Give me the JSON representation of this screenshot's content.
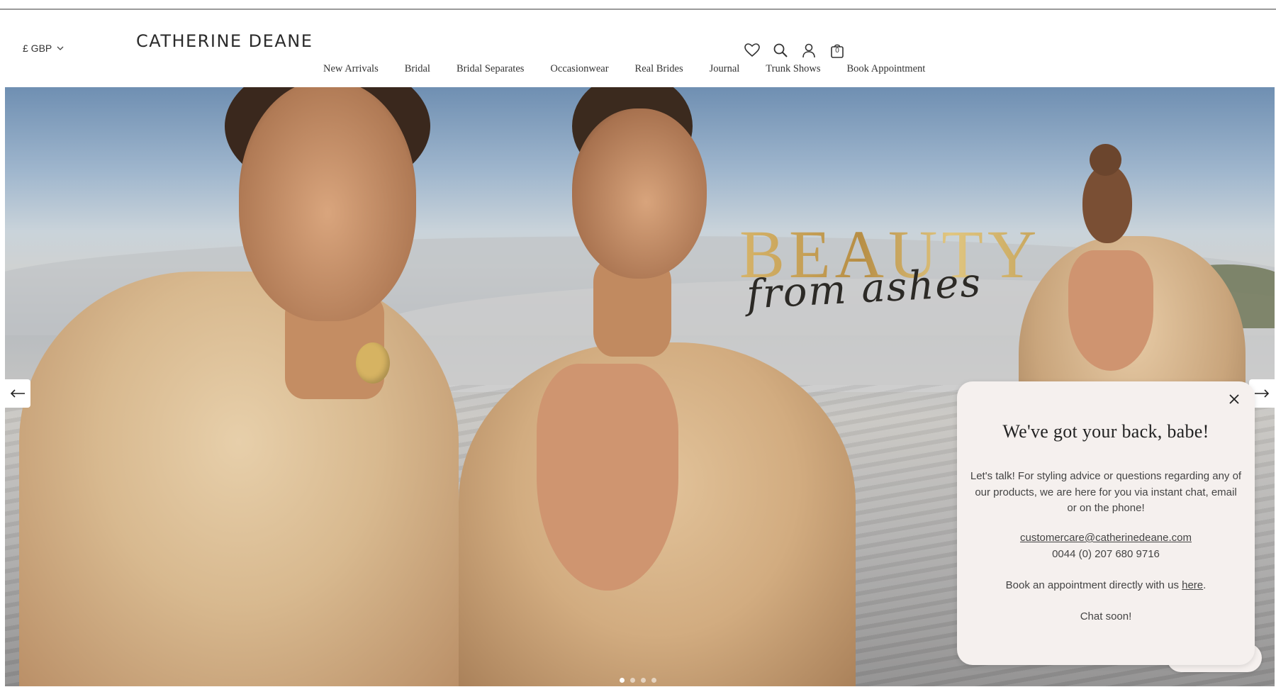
{
  "header": {
    "currency": "£ GBP",
    "logo": "CATHERINE DEANE",
    "icons": [
      "heart-icon",
      "search-icon",
      "account-icon",
      "bag-icon"
    ],
    "bag_count": "0",
    "nav": [
      "New Arrivals",
      "Bridal",
      "Bridal Separates",
      "Occasionwear",
      "Real Brides",
      "Journal",
      "Trunk Shows",
      "Book Appointment"
    ]
  },
  "hero": {
    "headline": "BEAUTY",
    "subheadline": "from ashes",
    "slide_count": 4,
    "active_slide": 1
  },
  "popup": {
    "title": "We've got your back, babe!",
    "message": "Let's talk! For styling advice or questions regarding any of our products, we are here for you via instant chat, email or on the phone!",
    "email": "customercare@catherinedeane.com",
    "phone": "0044 (0) 207 680 9716",
    "book_prefix": "Book an appointment directly with us ",
    "book_link": "here",
    "book_suffix": ".",
    "signoff": "Chat soon!"
  },
  "colors": {
    "accent_gold": "#c9a35a",
    "popup_bg": "#f5f0ee"
  }
}
